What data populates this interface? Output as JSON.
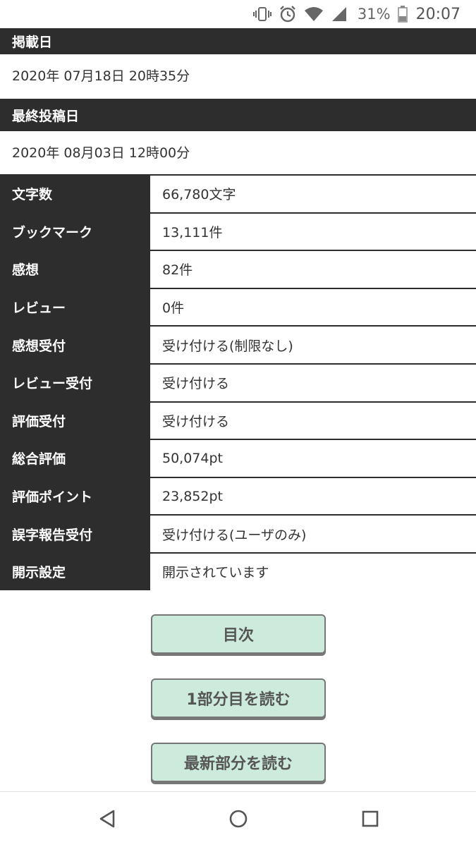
{
  "status_bar": {
    "battery_percent": "31%",
    "time": "20:07",
    "icons": [
      "vibrate-icon",
      "alarm-icon",
      "wifi-icon",
      "signal-icon",
      "battery-icon"
    ]
  },
  "published": {
    "label": "掲載日",
    "value": "2020年 07月18日 20時35分"
  },
  "last_posted": {
    "label": "最終投稿日",
    "value": "2020年 08月03日 12時00分"
  },
  "info_rows": [
    {
      "label": "文字数",
      "value": "66,780文字"
    },
    {
      "label": "ブックマーク",
      "value": "13,111件"
    },
    {
      "label": "感想",
      "value": "82件"
    },
    {
      "label": "レビュー",
      "value": "0件"
    },
    {
      "label": "感想受付",
      "value": "受け付ける(制限なし)"
    },
    {
      "label": "レビュー受付",
      "value": "受け付ける"
    },
    {
      "label": "評価受付",
      "value": "受け付ける"
    },
    {
      "label": "総合評価",
      "value": "50,074pt"
    },
    {
      "label": "評価ポイント",
      "value": "23,852pt"
    },
    {
      "label": "誤字報告受付",
      "value": "受け付ける(ユーザのみ)"
    },
    {
      "label": "開示設定",
      "value": "開示されています"
    }
  ],
  "buttons": {
    "toc": "目次",
    "read_first": "1部分目を読む",
    "read_latest": "最新部分を読む"
  },
  "colors": {
    "header_bg": "#2d2d2d",
    "button_bg": "#cdebdc"
  },
  "nav_bar": {
    "icons": [
      "back-icon",
      "home-icon",
      "recents-icon"
    ]
  }
}
